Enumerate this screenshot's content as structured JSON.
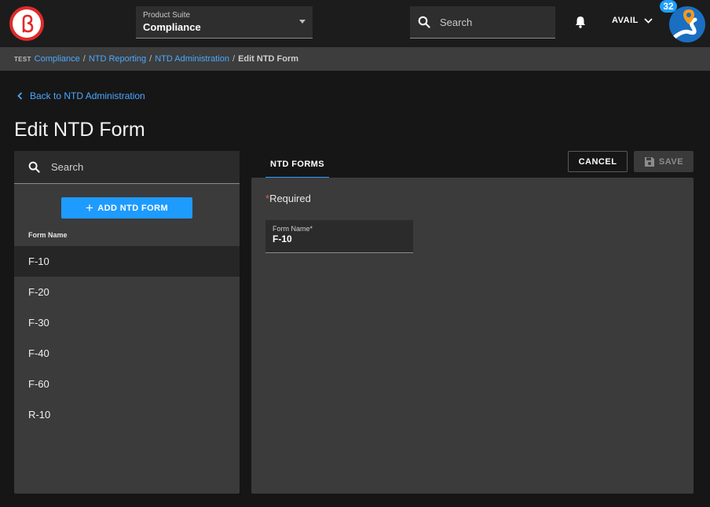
{
  "header": {
    "product_suite_label": "Product Suite",
    "product_suite_value": "Compliance",
    "search_placeholder": "Search",
    "user_label": "AVAIL",
    "notification_count": "32"
  },
  "breadcrumb": {
    "env": "TEST",
    "items": [
      "Compliance",
      "NTD Reporting",
      "NTD Administration"
    ],
    "separator": "/",
    "current": "Edit NTD Form"
  },
  "page": {
    "back_label": "Back to NTD Administration",
    "title": "Edit NTD Form"
  },
  "left_panel": {
    "search_placeholder": "Search",
    "add_button_label": "ADD NTD FORM",
    "column_header": "Form Name",
    "forms": [
      "F-10",
      "F-20",
      "F-30",
      "F-40",
      "F-60",
      "R-10"
    ],
    "selected_index": 0
  },
  "right_panel": {
    "tab_label": "NTD FORMS",
    "cancel_label": "CANCEL",
    "save_label": "SAVE",
    "required_text": "Required",
    "required_star": "*",
    "field_label": "Form Name*",
    "field_value": "F-10"
  },
  "colors": {
    "accent": "#1e9bff",
    "link": "#4aa8ff",
    "brand_red": "#e02a2a",
    "background": "#161616",
    "panel": "#3b3b3b"
  },
  "icons": {
    "logo": "beta-logo-icon",
    "search": "search-icon",
    "dropdown": "caret-down-icon",
    "notifications": "bell-icon",
    "user_menu": "chevron-down-icon",
    "app": "location-pin-road-icon",
    "back": "chevron-left-icon",
    "add": "plus-icon",
    "save": "floppy-disk-icon"
  }
}
